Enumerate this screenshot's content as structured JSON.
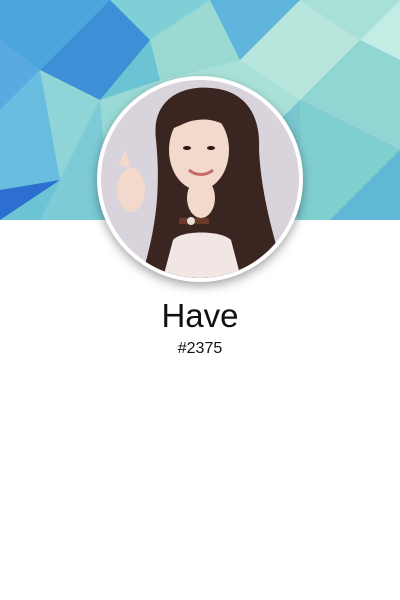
{
  "profile": {
    "name": "Have",
    "tag": "#2375"
  },
  "cover": {
    "palette": [
      "#3d8fd6",
      "#5fb4dc",
      "#7fd0cf",
      "#a6e0d6",
      "#c3ece4",
      "#2d6fd0"
    ]
  }
}
